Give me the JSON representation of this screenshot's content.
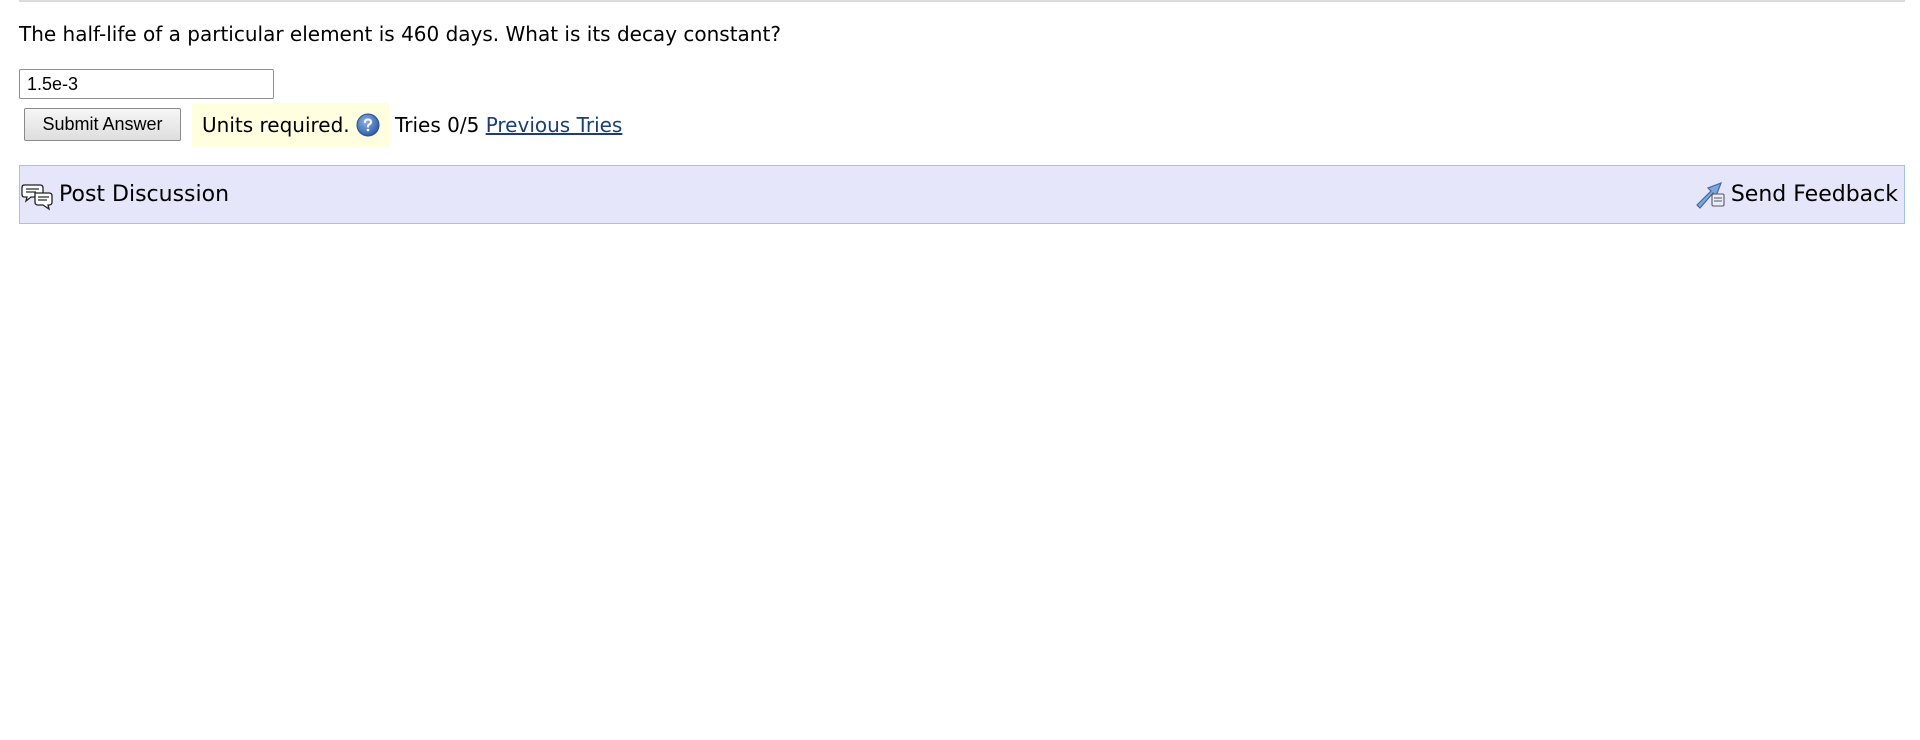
{
  "question": {
    "text": "The half-life of a particular element is 460 days. What is its decay constant?"
  },
  "answer": {
    "value": "1.5e-3"
  },
  "actions": {
    "submit_label": "Submit Answer",
    "units_message": "Units required.",
    "help_icon": "question-circle-icon",
    "tries_text": "Tries 0/5",
    "previous_tries_label": "Previous Tries"
  },
  "discussion_bar": {
    "post_discussion_label": "Post Discussion",
    "post_discussion_icon": "speech-bubbles-icon",
    "send_feedback_label": "Send Feedback",
    "send_feedback_icon": "feedback-arrow-icon"
  },
  "colors": {
    "units_background": "#ffffe0",
    "bar_background": "#e6e6fa",
    "bar_border": "#a0c4e4",
    "link": "#1a3f78"
  }
}
